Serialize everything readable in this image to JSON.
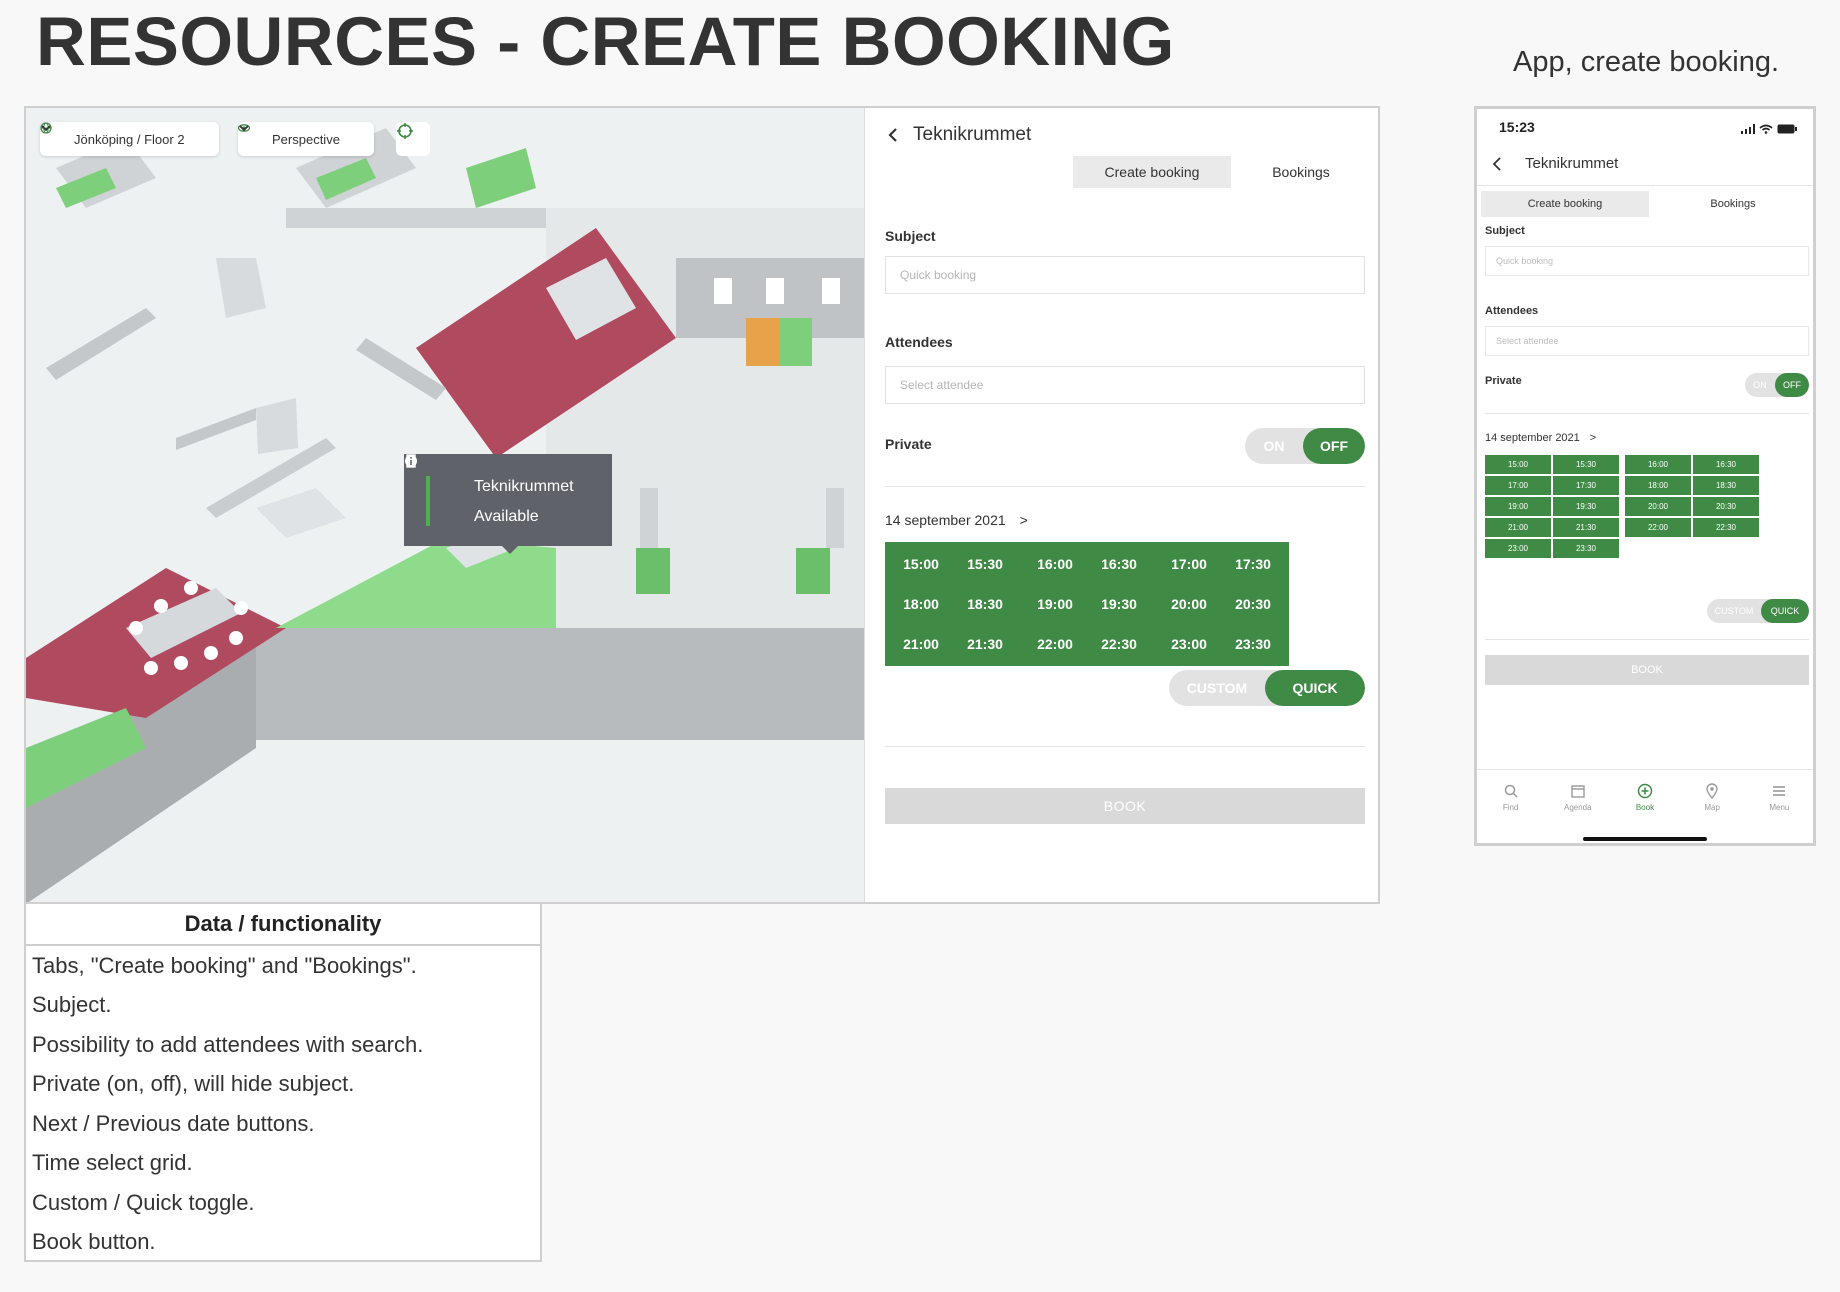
{
  "page_title": "RESOURCES - CREATE BOOKING",
  "app_caption": "App, create booking.",
  "desktop": {
    "map": {
      "location": "Jönköping / Floor 2",
      "view_mode": "Perspective",
      "tooltip": {
        "name": "Teknikrummet",
        "status": "Available"
      }
    },
    "panel": {
      "title": "Teknikrummet",
      "tabs": [
        "Create booking",
        "Bookings"
      ],
      "subject_label": "Subject",
      "subject_placeholder": "Quick booking",
      "attendees_label": "Attendees",
      "attendees_placeholder": "Select attendee",
      "private_label": "Private",
      "private_on": "ON",
      "private_off": "OFF",
      "date": "14 september 2021",
      "date_next": ">",
      "time_slots": [
        "15:00",
        "15:30",
        "16:00",
        "16:30",
        "17:00",
        "17:30",
        "18:00",
        "18:30",
        "19:00",
        "19:30",
        "20:00",
        "20:30",
        "21:00",
        "21:30",
        "22:00",
        "22:30",
        "23:00",
        "23:30"
      ],
      "mode_custom": "CUSTOM",
      "mode_quick": "QUICK",
      "book_label": "BOOK"
    }
  },
  "functionality": {
    "header": "Data / functionality",
    "rows": [
      "Tabs, \"Create booking\" and \"Bookings\".",
      "Subject.",
      "Possibility to add attendees with search.",
      "Private (on, off), will hide subject.",
      "Next / Previous date buttons.",
      "Time select grid.",
      "Custom / Quick toggle.",
      "Book button."
    ]
  },
  "phone": {
    "time": "15:23",
    "title": "Teknikrummet",
    "tabs": [
      "Create booking",
      "Bookings"
    ],
    "subject_label": "Subject",
    "subject_placeholder": "Quick booking",
    "attendees_label": "Attendees",
    "attendees_placeholder": "Select attendee",
    "private_label": "Private",
    "private_on": "ON",
    "private_off": "OFF",
    "date": "14 september 2021",
    "date_next": ">",
    "time_slots": [
      "15:00",
      "15:30",
      "16:00",
      "16:30",
      "17:00",
      "17:30",
      "18:00",
      "18:30",
      "19:00",
      "19:30",
      "20:00",
      "20:30",
      "21:00",
      "21:30",
      "22:00",
      "22:30",
      "23:00",
      "23:30"
    ],
    "mode_custom": "CUSTOM",
    "mode_quick": "QUICK",
    "book_label": "BOOK",
    "nav": [
      "Find",
      "Agenda",
      "Book",
      "Map",
      "Menu"
    ]
  },
  "colors": {
    "accent_green": "#3f8a45",
    "booked_red": "#b04a5e",
    "free_green": "#8edb8c",
    "orange": "#e7a24a"
  }
}
